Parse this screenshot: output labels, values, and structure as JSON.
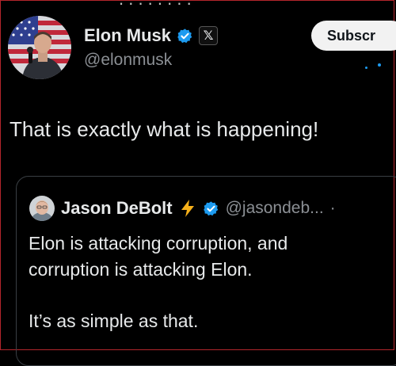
{
  "tweet": {
    "author": {
      "display_name": "Elon Musk",
      "handle": "@elonmusk",
      "verified": true,
      "affiliation_badge": "𝕏"
    },
    "subscribe_label": "Subscr",
    "text": "That is exactly what is happening!"
  },
  "quoted_tweet": {
    "author": {
      "display_name": "Jason DeBolt",
      "emoji": "lightning-bolt-icon",
      "verified": true,
      "handle": "@jasondeb..."
    },
    "lines": [
      "Elon is attacking corruption, and",
      "corruption is attacking Elon."
    ],
    "closing_line": "It’s as simple as that."
  },
  "colors": {
    "background": "#000000",
    "text": "#e7e9ea",
    "muted": "#8b8f94",
    "verified_blue": "#1d9bf0",
    "card_border": "#3a3f44",
    "frame_red": "#b3262c"
  }
}
